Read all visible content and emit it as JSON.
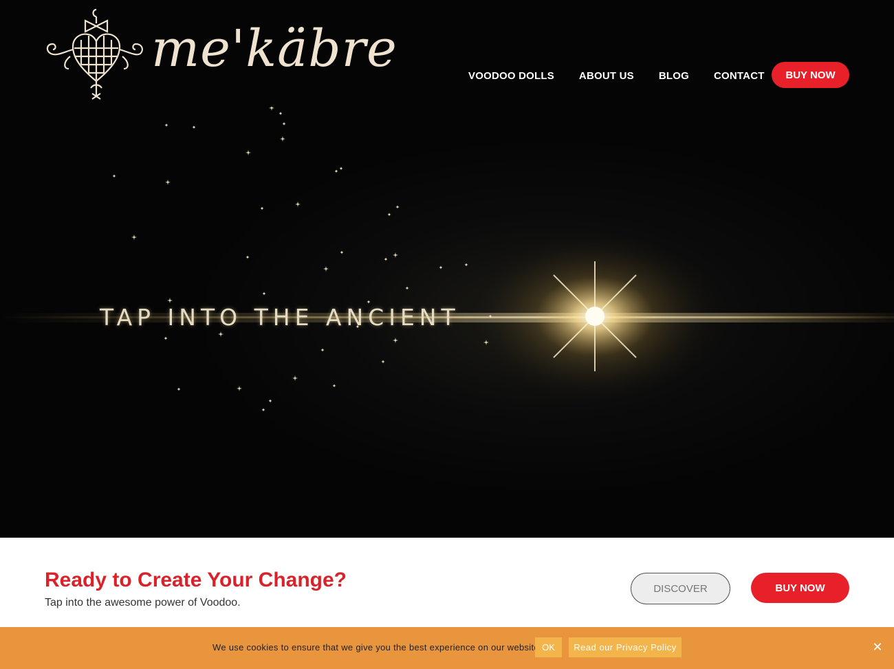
{
  "brand": {
    "name": "me'käbre",
    "logo_icon": "veve-heart-emblem-icon",
    "wordmark_color": "#efe3d0"
  },
  "nav": {
    "items": [
      {
        "label": "VOODOO DOLLS"
      },
      {
        "label": "ABOUT US"
      },
      {
        "label": "BLOG"
      },
      {
        "label": "CONTACT"
      }
    ],
    "buy_label": "BUY NOW"
  },
  "hero": {
    "title": "TAP INTO THE ANCIENT"
  },
  "cta": {
    "heading": "Ready to Create Your Change?",
    "subheading": "Tap into the awesome power of Voodoo.",
    "discover_label": "DISCOVER",
    "buy_label": "BUY NOW"
  },
  "cookie": {
    "message": "We use cookies to ensure that we give you the best experience on our website.",
    "ok_label": "OK",
    "policy_label": "Read our Privacy Policy",
    "close_icon": "close-icon"
  },
  "colors": {
    "accent_red": "#e8202a",
    "heading_red": "#d8232a",
    "cookie_bar": "#e8953e",
    "cookie_button": "#f4b44c"
  }
}
